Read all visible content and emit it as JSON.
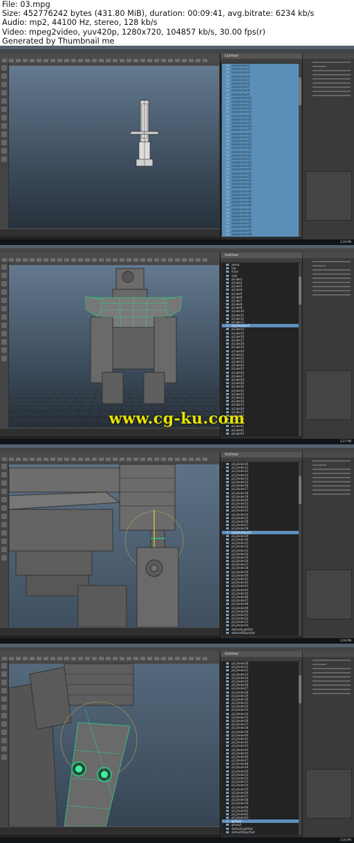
{
  "info": {
    "file": "File: 03.mpg",
    "size": "Size: 452776242 bytes (431.80 MiB), duration: 00:09:41, avg.bitrate: 6234 kb/s",
    "audio": "Audio: mp2, 44100 Hz, stereo, 128 kb/s",
    "video": "Video: mpeg2video, yuv420p, 1280x720, 104857 kb/s, 30.00 fps(r)",
    "generator": "Generated by Thumbnail me"
  },
  "watermark": "www.cg-ku.com",
  "frames": [
    {
      "outliner_title": "Outliner",
      "outliner_style": "blue",
      "clock": "3:26 PM",
      "rows": [
        "polySurface1",
        "polySurface2",
        "polySurface3",
        "polySurface4",
        "polySurface5",
        "polySurface6",
        "polySurface7",
        "polySurface8",
        "polySurface9",
        "polySurface10",
        "polySurface11",
        "polySurface12",
        "polySurface13",
        "polySurface14",
        "polySurface15",
        "polySurface16",
        "polySurface17",
        "polySurface18",
        "polySurface19",
        "polySurface20",
        "polySurface21",
        "polySurface22",
        "polySurface23",
        "polySurface24",
        "polySurface25",
        "polySurface26",
        "polySurface27",
        "polySurface28",
        "polySurface29",
        "polySurface30",
        "polySurface31",
        "polySurface32",
        "polySurface33",
        "polySurface34",
        "polySurface35",
        "polySurface36",
        "polySurface37",
        "polySurface38",
        "polySurface39",
        "polySurface40",
        "polySurface41",
        "polySurface42",
        "polySurface43",
        "polySurface44",
        "polySurface45",
        "polySurface46",
        "polySurface47",
        "polySurface48"
      ]
    },
    {
      "outliner_title": "Outliner",
      "outliner_style": "dark",
      "clock": "3:27 PM",
      "rows": [
        "persp",
        "top",
        "front",
        "side",
        "pCube1",
        "pCube2",
        "pCube3",
        "pCube4",
        "pCube5",
        "pCube6",
        "pCube7",
        "pCube8",
        "pCube9",
        "pCube10",
        "pCube11",
        "pCube12",
        "pCube13",
        "polySurface1",
        "pCube14",
        "pCube15",
        "pCube16",
        "pCube17",
        "pCube18",
        "pCube19",
        "pCube20",
        "pCube21",
        "pCube22",
        "pCube23",
        "pCube24",
        "pCube25",
        "pCube26",
        "pCube27",
        "pCube28",
        "pCube29",
        "pCube30",
        "pCube31",
        "pCube32",
        "pCube33",
        "pCube34",
        "pCube35",
        "pCube36",
        "pCube37",
        "pCube38",
        "pCube39",
        "pCube40",
        "pCube41",
        "pCube42",
        "pCube43"
      ],
      "selected_index": 17
    },
    {
      "outliner_title": "Outliner",
      "outliner_style": "dark",
      "clock": "3:28 PM",
      "rows": [
        "pCylinder10",
        "pCylinder11",
        "pCylinder12",
        "pCylinder13",
        "pCylinder14",
        "pCylinder15",
        "pCylinder16",
        "pCylinder17",
        "pCylinder18",
        "pCylinder19",
        "pCylinder20",
        "pCylinder21",
        "pCylinder22",
        "pCylinder23",
        "pCylinder24",
        "pCylinder25",
        "pCylinder26",
        "pCylinder27",
        "pCylinder28",
        "polySurface21",
        "pCylinder29",
        "pCylinder30",
        "pCylinder31",
        "pCylinder32",
        "pCylinder33",
        "pCylinder34",
        "pCylinder35",
        "pCylinder36",
        "pCylinder37",
        "pCylinder38",
        "pCylinder39",
        "pCylinder40",
        "pCylinder41",
        "pCylinder42",
        "pCylinder43",
        "pCylinder44",
        "pCylinder45",
        "pCylinder46",
        "pCylinder47",
        "pCylinder48",
        "pCylinder49",
        "pCylinder50",
        "pCylinder51",
        "pCylinder52",
        "pCylinder53",
        "pCylinder54",
        "defaultLightSet",
        "defaultObjectSet"
      ],
      "selected_index": 19
    },
    {
      "outliner_title": "Outliner",
      "outliner_style": "dark",
      "clock": "3:30 PM",
      "rows": [
        "pCylinder20",
        "pCylinder21",
        "pCylinder22",
        "pCylinder23",
        "pCylinder24",
        "pCylinder25",
        "pCylinder26",
        "pCylinder27",
        "pCylinder28",
        "pCylinder29",
        "pCylinder30",
        "pCylinder31",
        "pCylinder32",
        "pCylinder33",
        "pCylinder34",
        "pCylinder35",
        "pCylinder36",
        "pCylinder37",
        "pCylinder38",
        "pCylinder39",
        "pCylinder40",
        "pCylinder41",
        "pCylinder42",
        "pCylinder43",
        "pCylinder44",
        "pCylinder45",
        "pCylinder46",
        "pCylinder47",
        "pCylinder48",
        "pCylinder49",
        "pCylinder50",
        "pCylinder51",
        "pCylinder52",
        "pCylinder53",
        "pCylinder54",
        "pCylinder55",
        "pCylinder56",
        "pCylinder57",
        "pCylinder58",
        "pCylinder59",
        "pCylinder60",
        "pCylinder61",
        "pCylinder62",
        "pCylinder63",
        "group1",
        "group2",
        "defaultLightSet",
        "defaultObjectSet"
      ],
      "selected_index": 44
    }
  ]
}
